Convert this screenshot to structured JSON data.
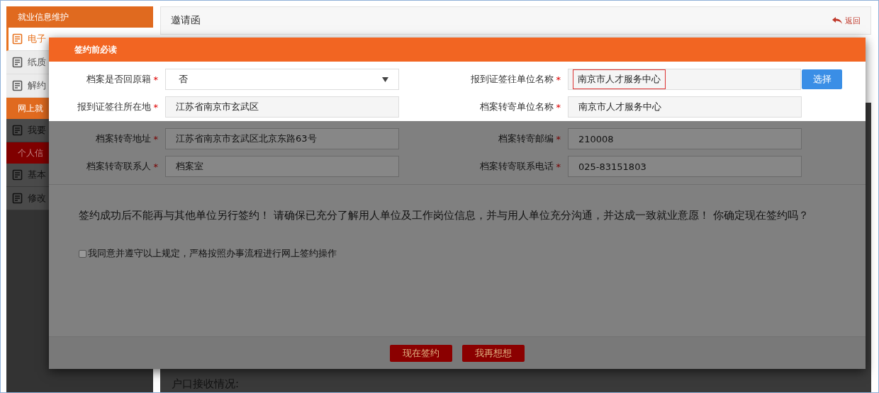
{
  "sidebar": {
    "groups": [
      {
        "title": "就业信息维护",
        "color": "#e06a1f",
        "items": [
          {
            "label": "电子",
            "selected": true
          },
          {
            "label": "纸质",
            "selected": false
          },
          {
            "label": "解约",
            "selected": false
          }
        ]
      },
      {
        "title": "网上就",
        "color": "#e06a1f",
        "items": [
          {
            "label": "我要",
            "selected": false
          }
        ]
      },
      {
        "title": "个人信",
        "color": "#800000",
        "items": [
          {
            "label": "基本",
            "selected": false
          },
          {
            "label": "修改",
            "selected": false
          }
        ]
      }
    ]
  },
  "page": {
    "title": "邀请函",
    "back_link": "返回",
    "section_label": "户口接收情况:"
  },
  "dialog": {
    "title": "签约前必读",
    "fields": [
      {
        "kind": "select",
        "label": "档案是否回原籍",
        "marker": "*",
        "value": "否",
        "invalid": false
      },
      {
        "kind": "picker",
        "label": "报到证签往单位名称",
        "marker": "*",
        "value": "南京市人才服务中心",
        "invalid": true,
        "button": "选择"
      },
      {
        "kind": "text",
        "label": "报到证签往所在地",
        "marker": "*",
        "value": "江苏省南京市玄武区",
        "invalid": false
      },
      {
        "kind": "text",
        "label": "档案转寄单位名称",
        "marker": "*",
        "value": "南京市人才服务中心",
        "invalid": false
      },
      {
        "kind": "text",
        "label": "档案转寄地址",
        "marker": "*",
        "value": "江苏省南京市玄武区北京东路63号",
        "invalid": false
      },
      {
        "kind": "text",
        "label": "档案转寄邮编",
        "marker": "*",
        "value": "210008",
        "invalid": false
      },
      {
        "kind": "text",
        "label": "档案转寄联系人",
        "marker": "*",
        "value": "档案室",
        "invalid": false
      },
      {
        "kind": "text",
        "label": "档案转寄联系电话",
        "marker": "*",
        "value": "025-83151803",
        "invalid": false
      }
    ],
    "message": "签约成功后不能再与其他单位另行签约！ 请确保已充分了解用人单位及工作岗位信息，并与用人单位充分沟通，并达成一致就业意愿！ 你确定现在签约吗？",
    "agreement": {
      "label": "我同意并遵守以上规定，严格按照办事流程进行网上签约操作",
      "checked": false
    },
    "buttons": [
      "现在签约",
      "我再想想"
    ]
  }
}
